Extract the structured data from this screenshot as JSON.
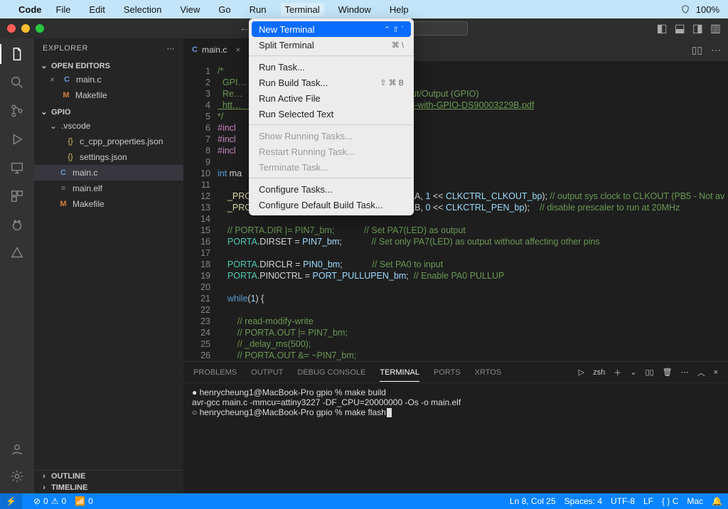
{
  "macbar": {
    "app": "Code",
    "items": [
      "File",
      "Edit",
      "Selection",
      "View",
      "Go",
      "Run",
      "Terminal",
      "Window",
      "Help"
    ],
    "open_index": 6,
    "battery": "100%"
  },
  "menu": {
    "groups": [
      [
        {
          "label": "New Terminal",
          "shortcut": "⌃ ⇧ `",
          "selected": true
        },
        {
          "label": "Split Terminal",
          "shortcut": "⌘ \\"
        }
      ],
      [
        {
          "label": "Run Task..."
        },
        {
          "label": "Run Build Task...",
          "shortcut": "⇧ ⌘ B"
        },
        {
          "label": "Run Active File"
        },
        {
          "label": "Run Selected Text"
        }
      ],
      [
        {
          "label": "Show Running Tasks...",
          "disabled": true
        },
        {
          "label": "Restart Running Task...",
          "disabled": true
        },
        {
          "label": "Terminate Task...",
          "disabled": true
        }
      ],
      [
        {
          "label": "Configure Tasks..."
        },
        {
          "label": "Configure Default Build Task..."
        }
      ]
    ]
  },
  "sidebar": {
    "header": "EXPLORER",
    "open_editors": "OPEN EDITORS",
    "open_items": [
      {
        "icon": "c",
        "label": "main.c",
        "close": true
      },
      {
        "icon": "m",
        "label": "Makefile"
      }
    ],
    "ws": "GPIO",
    "tree": [
      {
        "type": "folder",
        "label": ".vscode"
      },
      {
        "type": "file",
        "icon": "j",
        "label": "c_cpp_properties.json",
        "indent": 3
      },
      {
        "type": "file",
        "icon": "j",
        "label": "settings.json",
        "indent": 3
      },
      {
        "type": "file",
        "icon": "c",
        "label": "main.c",
        "indent": 2,
        "selected": true
      },
      {
        "type": "file",
        "icon": "e",
        "label": "main.elf",
        "indent": 2
      },
      {
        "type": "file",
        "icon": "m",
        "label": "Makefile",
        "indent": 2
      }
    ],
    "outline": "OUTLINE",
    "timeline": "TIMELINE"
  },
  "tab": {
    "icon": "c",
    "label": "main.c"
  },
  "code": {
    "lines": [
      {
        "n": 1,
        "html": "<span class='cG'>/*</span>"
      },
      {
        "n": 2,
        "html": "<span class='cG'>  GPI…                                 utton input</span>"
      },
      {
        "n": 3,
        "html": "<span class='cG'>  Re…                                 ) General Purpose Input/Output (GPIO)</span>"
      },
      {
        "n": 4,
        "html": "<span class='cG u'>  htt…                                ppnotes/Getting-Started-with-GPIO-DS90003229B.pdf</span>"
      },
      {
        "n": 5,
        "html": "<span class='cG'>*/</span>"
      },
      {
        "n": 6,
        "html": "<span class='cM'>#incl</span>"
      },
      {
        "n": 7,
        "html": "<span class='cM'>#incl</span>"
      },
      {
        "n": 8,
        "html": "<span class='cM'>#incl</span>"
      },
      {
        "n": 9,
        "html": ""
      },
      {
        "n": 10,
        "html": "<span class='cK'>int</span> ma"
      },
      {
        "n": 11,
        "html": ""
      },
      {
        "n": 12,
        "html": "    <span class='cF'>_PROTECTED_WRITE</span>(<span class='cY'>CLKCTRL</span>.MCLKCTRLA, <span class='cB'>1</span> &lt;&lt; <span class='cB'>CLKCTRL_CLKOUT_bp</span>); <span class='cG'>// output sys clock to CLKOUT (PB5 - Not av</span>"
      },
      {
        "n": 13,
        "html": "    <span class='cF'>_PROTECTED_WRITE</span>(<span class='cY'>CLKCTRL</span>.MCLKCTRLB, <span class='cB'>0</span> &lt;&lt; <span class='cB'>CLKCTRL_PEN_bp</span>);    <span class='cG'>// disable prescaler to run at 20MHz</span>"
      },
      {
        "n": 14,
        "html": ""
      },
      {
        "n": 15,
        "html": "    <span class='cG'>// PORTA.DIR |= PIN7_bm;</span>            <span class='cG'>// Set PA7(LED) as output</span>"
      },
      {
        "n": 16,
        "html": "    <span class='cY'>PORTA</span>.DIRSET = <span class='cB'>PIN7_bm</span>;            <span class='cG'>// Set only PA7(LED) as output without affecting other pins</span>"
      },
      {
        "n": 17,
        "html": ""
      },
      {
        "n": 18,
        "html": "    <span class='cY'>PORTA</span>.DIRCLR = <span class='cB'>PIN0_bm</span>;            <span class='cG'>// Set PA0 to input</span>"
      },
      {
        "n": 19,
        "html": "    <span class='cY'>PORTA</span>.PIN0CTRL = <span class='cB'>PORT_PULLUPEN_bm</span>;  <span class='cG'>// Enable PA0 PULLUP</span>"
      },
      {
        "n": 20,
        "html": ""
      },
      {
        "n": 21,
        "html": "    <span class='cK'>while</span>(<span class='cB'>1</span>) {"
      },
      {
        "n": 22,
        "html": ""
      },
      {
        "n": 23,
        "html": "        <span class='cG'>// read-modify-write</span>"
      },
      {
        "n": 24,
        "html": "        <span class='cG'>// PORTA.OUT |= PIN7_bm;</span>"
      },
      {
        "n": 25,
        "html": "        <span class='cG'>// _delay_ms(500);</span>"
      },
      {
        "n": 26,
        "html": "        <span class='cG'>// PORTA.OUT &amp;= ~PIN7_bm;</span>"
      }
    ]
  },
  "panel": {
    "tabs": [
      "PROBLEMS",
      "OUTPUT",
      "DEBUG CONSOLE",
      "TERMINAL",
      "PORTS",
      "XRTOS"
    ],
    "active": 3,
    "shell": "zsh",
    "lines": [
      "● henrycheung1@MacBook-Pro gpio % make build",
      "  avr-gcc main.c -mmcu=attiny3227 -DF_CPU=20000000 -Os -o main.elf",
      "○ henrycheung1@MacBook-Pro gpio % make flash"
    ]
  },
  "status": {
    "errors": "0",
    "warnings": "0",
    "radio": "0",
    "lncol": "Ln 8, Col 25",
    "spaces": "Spaces: 4",
    "enc": "UTF-8",
    "eol": "LF",
    "lang": "{ } C",
    "host": "Mac"
  }
}
